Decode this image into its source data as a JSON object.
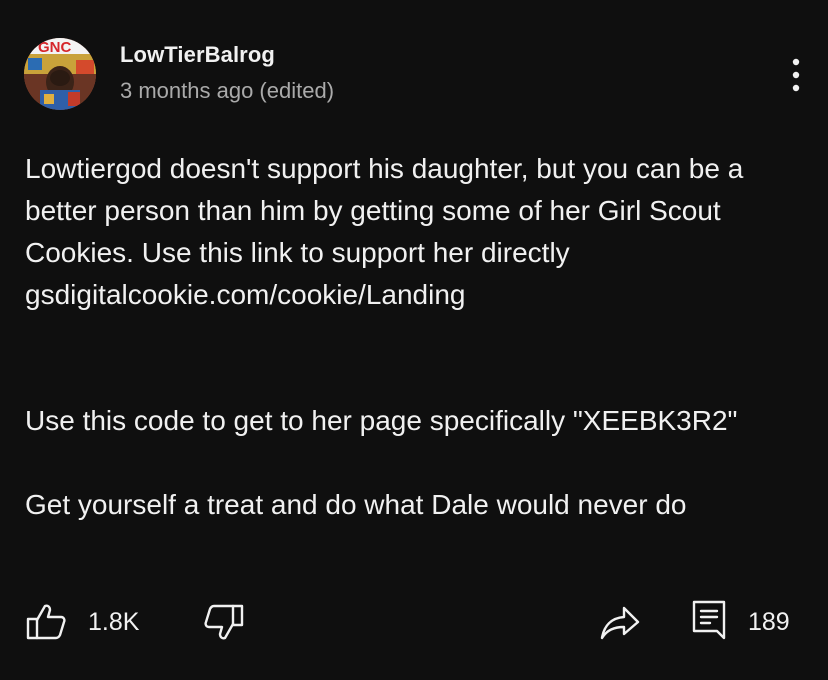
{
  "comment": {
    "author": "LowTierBalrog",
    "meta": "3 months ago (edited)",
    "avatar_text": "GNC",
    "paragraphs": [
      "Lowtiergod doesn't support his daughter, but you can be a better person than him by getting some of her Girl Scout Cookies. Use this link to support her directly gsdigitalcookie.com/cookie/Landing",
      "",
      "",
      "Use this code to get to her page specifically \"XEEBK3R2\"",
      "",
      "Get yourself a treat and do what Dale would never do"
    ],
    "likes": "1.8K",
    "replies": "189"
  },
  "icons": {
    "like": "thumbs-up-icon",
    "dislike": "thumbs-down-icon",
    "share": "share-icon",
    "reply": "reply-icon",
    "menu": "more-vertical-icon"
  }
}
